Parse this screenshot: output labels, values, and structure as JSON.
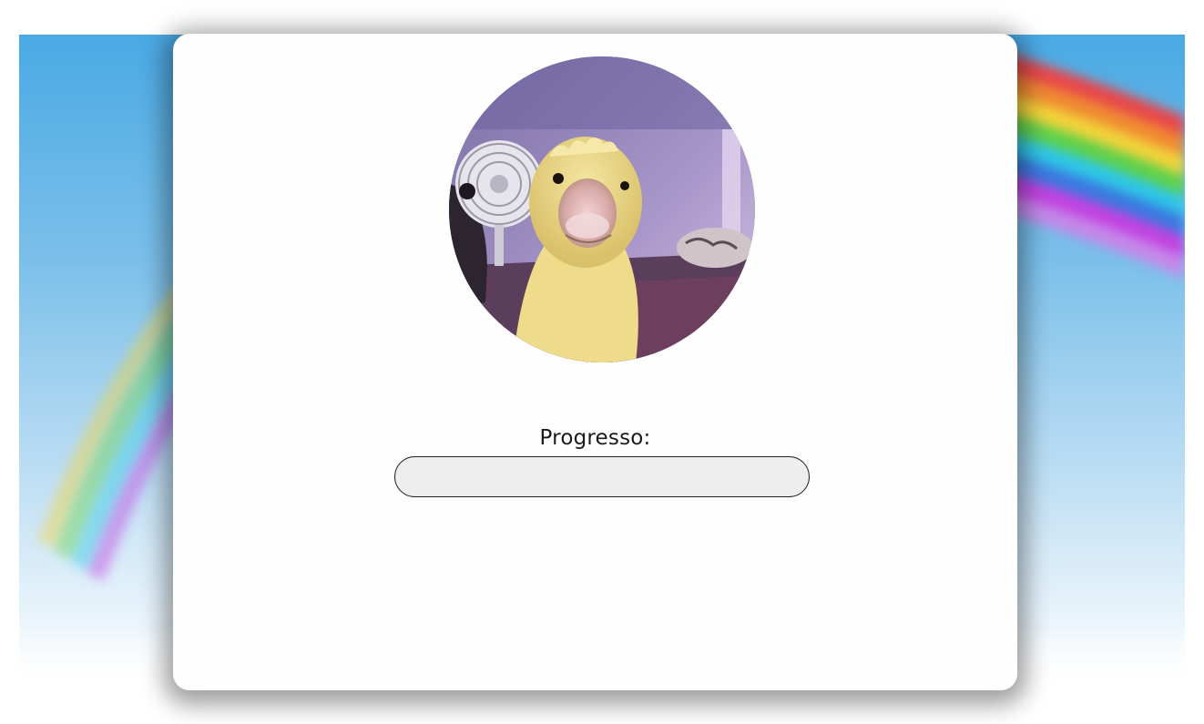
{
  "profile": {
    "avatar_icon": "duckling-photo"
  },
  "progress": {
    "label": "Progresso:",
    "value": 0,
    "fill_color": "#6bc36b",
    "track_color": "#eeeeee"
  },
  "background": {
    "sky_color": "#4aa9e4",
    "decoration": "rainbow"
  }
}
